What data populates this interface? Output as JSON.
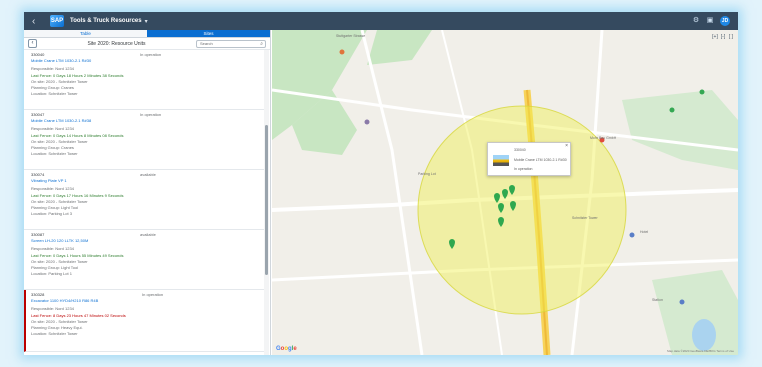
{
  "shell": {
    "title": "Tools & Truck Resources",
    "back_icon": "chevron-left-icon",
    "logo_text": "SAP",
    "avatar_initials": "JD"
  },
  "tabs": [
    {
      "label": "Table"
    },
    {
      "label": "Sites"
    }
  ],
  "list": {
    "title": "Site 2020: Resource Units",
    "search_placeholder": "Search",
    "items": [
      {
        "id": "330040",
        "status": "In operation",
        "name": "Mobile Crane LTM 1030-2.1 R#30",
        "responsible": "Responsible: Nord 1234",
        "last_fence": "Last Fence: 0 Days 18 Hours 2 Minutes 38 Seconds",
        "onsite": "On site: 2020 - Schnitzler Tower",
        "group": "Planning Group: Cranes",
        "location": "Location: Schnitzler Tower",
        "alert": false
      },
      {
        "id": "330047",
        "status": "In operation",
        "name": "Mobile Crane LTM 1030-2.1 R#38",
        "responsible": "Responsible: Nord 1234",
        "last_fence": "Last Fence: 0 Days 14 Hours 8 Minutes 08 Seconds",
        "onsite": "On site: 2020 - Schnitzler Tower",
        "group": "Planning Group: Cranes",
        "location": "Location: Schnitzler Tower",
        "alert": false
      },
      {
        "id": "330074",
        "status": "available",
        "name": "Vibrating Plate VP 1",
        "responsible": "Responsible: Nord 1234",
        "last_fence": "Last Fence: 0 Days 17 Hours 16 Minutes 9 Seconds",
        "onsite": "On site: 2020 - Schnitzler Tower",
        "group": "Planning Group: Light Tool",
        "location": "Location: Parking Lot 3",
        "alert": false
      },
      {
        "id": "330087",
        "status": "available",
        "name": "Screen LH-20 120 LLTK 12,50M",
        "responsible": "Responsible: Nord 1234",
        "last_fence": "Last Fence: 0 Days 1 Hours 55 Minutes 49 Seconds",
        "onsite": "On site: 2020 - Schnitzler Tower",
        "group": "Planning Group: Light Tool",
        "location": "Location: Parking Lot 1",
        "alert": false
      },
      {
        "id": "330328",
        "status": "In operation",
        "name": "Excavator 1100 HYD4/H210 R86 R4B",
        "responsible": "Responsible: Nord 1234",
        "last_fence": "Last Fence: 8 Days 23 Hours 47 Minutes 02 Seconds",
        "onsite": "On site: 2020 - Schnitzler Tower",
        "group": "Planning Group: Heavy Equi.",
        "location": "Location: Schnitzler Tower",
        "alert": true
      }
    ]
  },
  "map": {
    "popup": {
      "line1": "330040",
      "line2": "Mobile Crane LTM 1030-2.1 R#30",
      "line3": "In operation"
    },
    "labels": {
      "l1": "Stuttgarter Strasse",
      "l2": "Schnitzler Tower",
      "l3": "Mohr Bau GmbH",
      "l4": "Parking Lot",
      "l5": "Hotel",
      "l6": "Station"
    },
    "attribution": "Map data ©2020 GeoBasis-DE/BKG Terms of Use"
  }
}
